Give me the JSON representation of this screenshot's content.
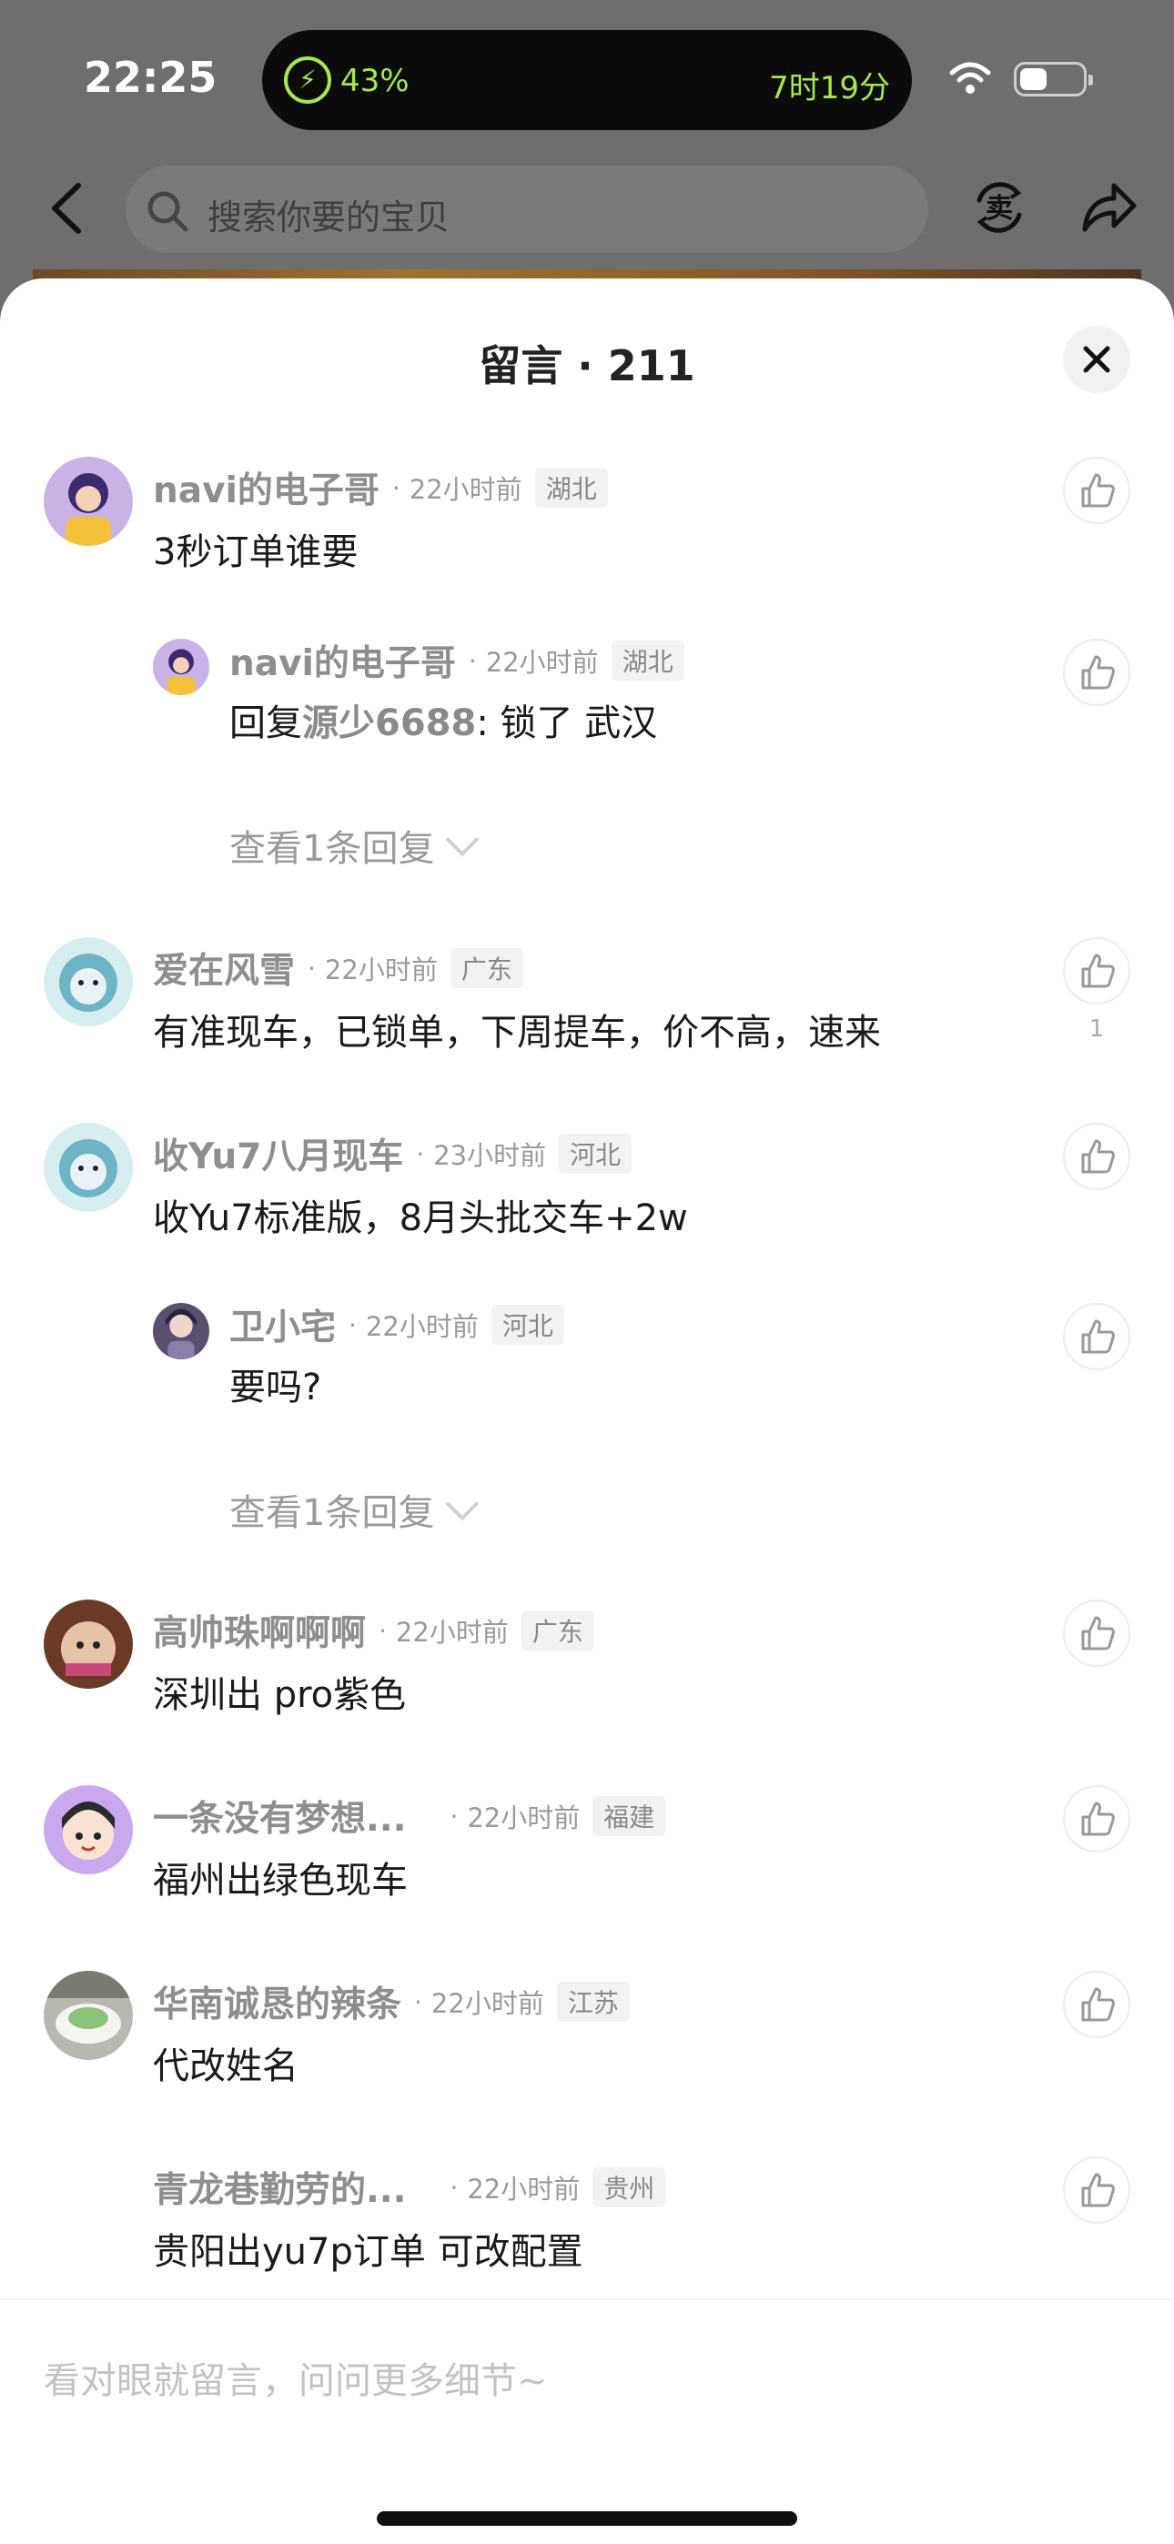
{
  "status_bar": {
    "time": "22:25",
    "battery_percent": "43%",
    "time_remaining": "7时19分",
    "battery_level_fraction": 0.43
  },
  "top_nav": {
    "search_placeholder": "搜索你要的宝贝",
    "sell_icon_char": "卖",
    "icons": [
      "back-icon",
      "search-icon",
      "sell-icon",
      "share-icon"
    ]
  },
  "sheet": {
    "title": "留言 · 211",
    "composer_placeholder": "看对眼就留言，问问更多细节~"
  },
  "comments": [
    {
      "name": "navi的电子哥",
      "time": "22小时前",
      "region": "湖北",
      "text": "3秒订单谁要"
    },
    {
      "name": "navi的电子哥",
      "time": "22小时前",
      "region": "湖北",
      "reply_prefix": "回复",
      "mention": "源少6688",
      "text": ": 锁了 武汉",
      "is_reply": true
    },
    {
      "name": "爱在风雪",
      "time": "22小时前",
      "region": "广东",
      "text": "有准现车，已锁单，下周提车，价不高，速来",
      "likes": "1"
    },
    {
      "name": "收Yu7八月现车",
      "time": "23小时前",
      "region": "河北",
      "text": "收Yu7标准版，8月头批交车+2w"
    },
    {
      "name": "卫小宅",
      "time": "22小时前",
      "region": "河北",
      "text": "要吗?",
      "is_reply": true
    },
    {
      "name": "高帅珠啊啊啊",
      "time": "22小时前",
      "region": "广东",
      "text": "深圳出 pro紫色"
    },
    {
      "name": "一条没有梦想...",
      "time": "22小时前",
      "region": "福建",
      "text": "福州出绿色现车"
    },
    {
      "name": "华南诚恳的辣条",
      "time": "22小时前",
      "region": "江苏",
      "text": "代改姓名"
    },
    {
      "name": "青龙巷勤劳的...",
      "time": "22小时前",
      "region": "贵州",
      "text": "贵阳出yu7p订单 可改配置"
    }
  ],
  "view_replies_label": "查看1条回复",
  "colors": {
    "sheet_bg": "#ffffff",
    "name_gray": "#8e8e8e",
    "battery_green": "#a6e84a",
    "dimmed_backdrop": "#6e6e6e"
  }
}
